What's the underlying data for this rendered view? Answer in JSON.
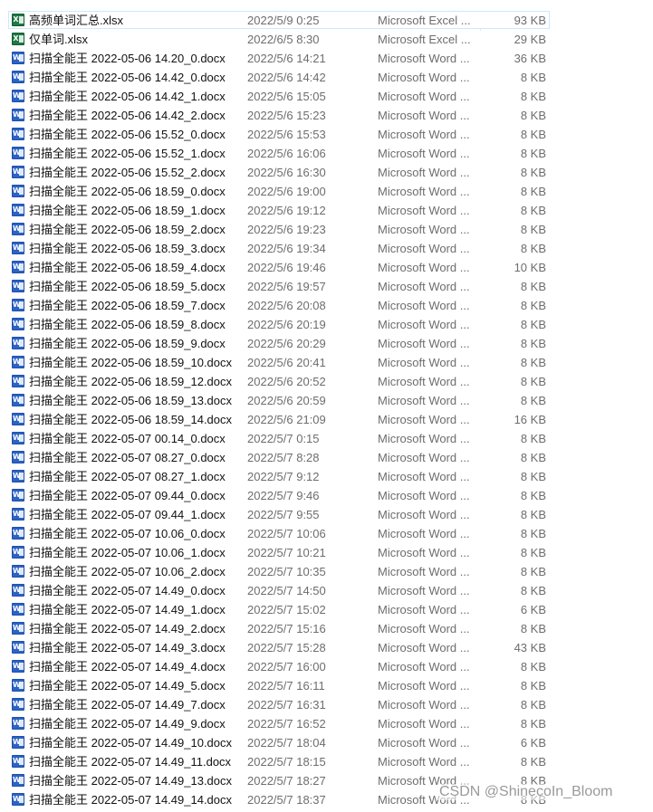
{
  "files": [
    {
      "name": "高频单词汇总.xlsx",
      "date": "2022/5/9 0:25",
      "type": "Microsoft Excel ...",
      "size": "93 KB",
      "icon": "excel-icon"
    },
    {
      "name": "仅单词.xlsx",
      "date": "2022/6/5 8:30",
      "type": "Microsoft Excel ...",
      "size": "29 KB",
      "icon": "excel-icon"
    },
    {
      "name": "扫描全能王 2022-05-06 14.20_0.docx",
      "date": "2022/5/6 14:21",
      "type": "Microsoft Word ...",
      "size": "36 KB",
      "icon": "word-icon"
    },
    {
      "name": "扫描全能王 2022-05-06 14.42_0.docx",
      "date": "2022/5/6 14:42",
      "type": "Microsoft Word ...",
      "size": "8 KB",
      "icon": "word-icon"
    },
    {
      "name": "扫描全能王 2022-05-06 14.42_1.docx",
      "date": "2022/5/6 15:05",
      "type": "Microsoft Word ...",
      "size": "8 KB",
      "icon": "word-icon"
    },
    {
      "name": "扫描全能王 2022-05-06 14.42_2.docx",
      "date": "2022/5/6 15:23",
      "type": "Microsoft Word ...",
      "size": "8 KB",
      "icon": "word-icon"
    },
    {
      "name": "扫描全能王 2022-05-06 15.52_0.docx",
      "date": "2022/5/6 15:53",
      "type": "Microsoft Word ...",
      "size": "8 KB",
      "icon": "word-icon"
    },
    {
      "name": "扫描全能王 2022-05-06 15.52_1.docx",
      "date": "2022/5/6 16:06",
      "type": "Microsoft Word ...",
      "size": "8 KB",
      "icon": "word-icon"
    },
    {
      "name": "扫描全能王 2022-05-06 15.52_2.docx",
      "date": "2022/5/6 16:30",
      "type": "Microsoft Word ...",
      "size": "8 KB",
      "icon": "word-icon"
    },
    {
      "name": "扫描全能王 2022-05-06 18.59_0.docx",
      "date": "2022/5/6 19:00",
      "type": "Microsoft Word ...",
      "size": "8 KB",
      "icon": "word-icon"
    },
    {
      "name": "扫描全能王 2022-05-06 18.59_1.docx",
      "date": "2022/5/6 19:12",
      "type": "Microsoft Word ...",
      "size": "8 KB",
      "icon": "word-icon"
    },
    {
      "name": "扫描全能王 2022-05-06 18.59_2.docx",
      "date": "2022/5/6 19:23",
      "type": "Microsoft Word ...",
      "size": "8 KB",
      "icon": "word-icon"
    },
    {
      "name": "扫描全能王 2022-05-06 18.59_3.docx",
      "date": "2022/5/6 19:34",
      "type": "Microsoft Word ...",
      "size": "8 KB",
      "icon": "word-icon"
    },
    {
      "name": "扫描全能王 2022-05-06 18.59_4.docx",
      "date": "2022/5/6 19:46",
      "type": "Microsoft Word ...",
      "size": "10 KB",
      "icon": "word-icon"
    },
    {
      "name": "扫描全能王 2022-05-06 18.59_5.docx",
      "date": "2022/5/6 19:57",
      "type": "Microsoft Word ...",
      "size": "8 KB",
      "icon": "word-icon"
    },
    {
      "name": "扫描全能王 2022-05-06 18.59_7.docx",
      "date": "2022/5/6 20:08",
      "type": "Microsoft Word ...",
      "size": "8 KB",
      "icon": "word-icon"
    },
    {
      "name": "扫描全能王 2022-05-06 18.59_8.docx",
      "date": "2022/5/6 20:19",
      "type": "Microsoft Word ...",
      "size": "8 KB",
      "icon": "word-icon"
    },
    {
      "name": "扫描全能王 2022-05-06 18.59_9.docx",
      "date": "2022/5/6 20:29",
      "type": "Microsoft Word ...",
      "size": "8 KB",
      "icon": "word-icon"
    },
    {
      "name": "扫描全能王 2022-05-06 18.59_10.docx",
      "date": "2022/5/6 20:41",
      "type": "Microsoft Word ...",
      "size": "8 KB",
      "icon": "word-icon"
    },
    {
      "name": "扫描全能王 2022-05-06 18.59_12.docx",
      "date": "2022/5/6 20:52",
      "type": "Microsoft Word ...",
      "size": "8 KB",
      "icon": "word-icon"
    },
    {
      "name": "扫描全能王 2022-05-06 18.59_13.docx",
      "date": "2022/5/6 20:59",
      "type": "Microsoft Word ...",
      "size": "8 KB",
      "icon": "word-icon"
    },
    {
      "name": "扫描全能王 2022-05-06 18.59_14.docx",
      "date": "2022/5/6 21:09",
      "type": "Microsoft Word ...",
      "size": "16 KB",
      "icon": "word-icon"
    },
    {
      "name": "扫描全能王 2022-05-07 00.14_0.docx",
      "date": "2022/5/7 0:15",
      "type": "Microsoft Word ...",
      "size": "8 KB",
      "icon": "word-icon"
    },
    {
      "name": "扫描全能王 2022-05-07 08.27_0.docx",
      "date": "2022/5/7 8:28",
      "type": "Microsoft Word ...",
      "size": "8 KB",
      "icon": "word-icon"
    },
    {
      "name": "扫描全能王 2022-05-07 08.27_1.docx",
      "date": "2022/5/7 9:12",
      "type": "Microsoft Word ...",
      "size": "8 KB",
      "icon": "word-icon"
    },
    {
      "name": "扫描全能王 2022-05-07 09.44_0.docx",
      "date": "2022/5/7 9:46",
      "type": "Microsoft Word ...",
      "size": "8 KB",
      "icon": "word-icon"
    },
    {
      "name": "扫描全能王 2022-05-07 09.44_1.docx",
      "date": "2022/5/7 9:55",
      "type": "Microsoft Word ...",
      "size": "8 KB",
      "icon": "word-icon"
    },
    {
      "name": "扫描全能王 2022-05-07 10.06_0.docx",
      "date": "2022/5/7 10:06",
      "type": "Microsoft Word ...",
      "size": "8 KB",
      "icon": "word-icon"
    },
    {
      "name": "扫描全能王 2022-05-07 10.06_1.docx",
      "date": "2022/5/7 10:21",
      "type": "Microsoft Word ...",
      "size": "8 KB",
      "icon": "word-icon"
    },
    {
      "name": "扫描全能王 2022-05-07 10.06_2.docx",
      "date": "2022/5/7 10:35",
      "type": "Microsoft Word ...",
      "size": "8 KB",
      "icon": "word-icon"
    },
    {
      "name": "扫描全能王 2022-05-07 14.49_0.docx",
      "date": "2022/5/7 14:50",
      "type": "Microsoft Word ...",
      "size": "8 KB",
      "icon": "word-icon"
    },
    {
      "name": "扫描全能王 2022-05-07 14.49_1.docx",
      "date": "2022/5/7 15:02",
      "type": "Microsoft Word ...",
      "size": "6 KB",
      "icon": "word-icon"
    },
    {
      "name": "扫描全能王 2022-05-07 14.49_2.docx",
      "date": "2022/5/7 15:16",
      "type": "Microsoft Word ...",
      "size": "8 KB",
      "icon": "word-icon"
    },
    {
      "name": "扫描全能王 2022-05-07 14.49_3.docx",
      "date": "2022/5/7 15:28",
      "type": "Microsoft Word ...",
      "size": "43 KB",
      "icon": "word-icon"
    },
    {
      "name": "扫描全能王 2022-05-07 14.49_4.docx",
      "date": "2022/5/7 16:00",
      "type": "Microsoft Word ...",
      "size": "8 KB",
      "icon": "word-icon"
    },
    {
      "name": "扫描全能王 2022-05-07 14.49_5.docx",
      "date": "2022/5/7 16:11",
      "type": "Microsoft Word ...",
      "size": "8 KB",
      "icon": "word-icon"
    },
    {
      "name": "扫描全能王 2022-05-07 14.49_7.docx",
      "date": "2022/5/7 16:31",
      "type": "Microsoft Word ...",
      "size": "8 KB",
      "icon": "word-icon"
    },
    {
      "name": "扫描全能王 2022-05-07 14.49_9.docx",
      "date": "2022/5/7 16:52",
      "type": "Microsoft Word ...",
      "size": "8 KB",
      "icon": "word-icon"
    },
    {
      "name": "扫描全能王 2022-05-07 14.49_10.docx",
      "date": "2022/5/7 18:04",
      "type": "Microsoft Word ...",
      "size": "6 KB",
      "icon": "word-icon"
    },
    {
      "name": "扫描全能王 2022-05-07 14.49_11.docx",
      "date": "2022/5/7 18:15",
      "type": "Microsoft Word ...",
      "size": "8 KB",
      "icon": "word-icon"
    },
    {
      "name": "扫描全能王 2022-05-07 14.49_13.docx",
      "date": "2022/5/7 18:27",
      "type": "Microsoft Word ...",
      "size": "8 KB",
      "icon": "word-icon"
    },
    {
      "name": "扫描全能王 2022-05-07 14.49_14.docx",
      "date": "2022/5/7 18:37",
      "type": "Microsoft Word ...",
      "size": "8 KB",
      "icon": "word-icon"
    }
  ],
  "selected_index": 0,
  "icon_colors": {
    "word": "#2b63c5",
    "excel": "#1d7a45"
  },
  "watermark": "CSDN @ShinecoIn_Bloom"
}
